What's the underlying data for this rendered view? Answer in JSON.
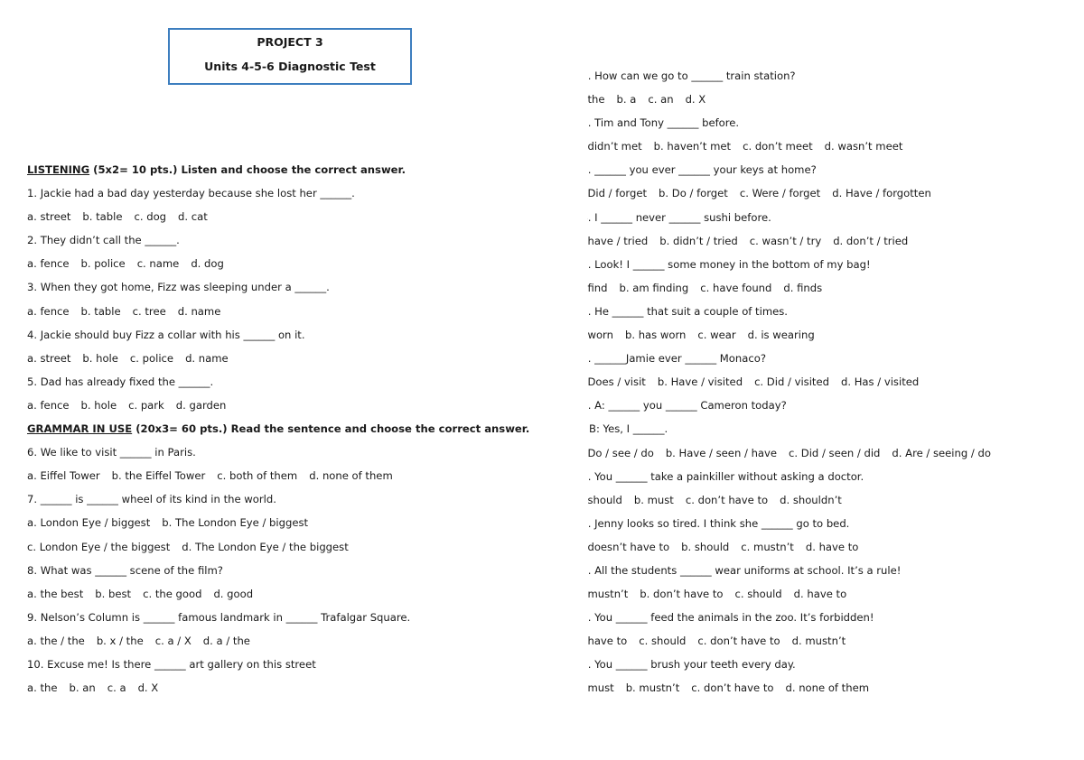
{
  "header": {
    "project": "PROJECT 3",
    "subtitle": "Units 4-5-6 Diagnostic Test"
  },
  "listening": {
    "label": "LISTENING",
    "instructions": " (5x2= 10 pts.) Listen and choose the correct answer.",
    "questions": [
      {
        "text": "1. Jackie had a bad day yesterday because she lost her ______.",
        "options": [
          "a. street",
          "b. table",
          "c. dog",
          "d. cat"
        ]
      },
      {
        "text": "2. They didn’t call the ______.",
        "options": [
          "a. fence",
          "b. police",
          "c. name",
          "d. dog"
        ]
      },
      {
        "text": "3. When they got home, Fizz was sleeping under a ______.",
        "options": [
          "a. fence",
          "b. table",
          "c. tree",
          "d. name"
        ]
      },
      {
        "text": "4. Jackie should buy Fizz a collar with his ______ on it.",
        "options": [
          "a. street",
          "b. hole",
          "c. police",
          "d. name"
        ]
      },
      {
        "text": "5. Dad has already fixed the ______.",
        "options": [
          "a. fence",
          "b. hole",
          "c. park",
          "d. garden"
        ]
      }
    ]
  },
  "grammar": {
    "label": "GRAMMAR IN USE",
    "instructions": " (20x3= 60 pts.) Read the sentence and choose the correct answer.",
    "questions": [
      {
        "text": "6. We like to visit ______ in Paris.",
        "options": [
          "a. Eiffel Tower",
          "b. the Eiffel Tower",
          "c. both of them",
          "d. none of them"
        ]
      },
      {
        "text": "7. ______ is ______ wheel of its kind in the world.",
        "options": [
          "a. London Eye / biggest",
          "b. The London Eye / biggest"
        ],
        "options2": [
          "c. London Eye / the biggest",
          "d. The London Eye / the biggest"
        ]
      },
      {
        "text": "8. What was ______ scene of the film?",
        "options": [
          "a. the best",
          "b. best",
          "c. the good",
          "d. good"
        ]
      },
      {
        "text": "9. Nelson’s Column is ______ famous landmark in ______ Trafalgar Square.",
        "options": [
          "a. the / the",
          "b. x / the",
          "c. a / X",
          "d. a / the"
        ]
      },
      {
        "text": "10. Excuse me! Is there ______ art gallery on this street",
        "options": [
          "a. the",
          "b. an",
          "c. a",
          "d. X"
        ]
      },
      {
        "text": "11. How can we go to ______ train station?",
        "options": [
          "a. the",
          "b. a",
          "c. an",
          "d. X"
        ]
      },
      {
        "text": "12. Tim and Tony ______ before.",
        "options": [
          "a. didn’t met",
          "b. haven’t met",
          "c. don’t meet",
          "d. wasn’t meet"
        ]
      },
      {
        "text": "13. ______ you ever ______ your keys at home?",
        "options": [
          "a. Did / forget",
          "b. Do / forget",
          "c. Were / forget",
          "d. Have / forgotten"
        ]
      },
      {
        "text": "14. I ______ never ______ sushi before.",
        "options": [
          "a. have / tried",
          "b. didn’t / tried",
          "c. wasn’t / try",
          "d. don’t / tried"
        ]
      },
      {
        "text": "15. Look! I ______ some money in the bottom of my bag!",
        "options": [
          "a. find",
          "b. am finding",
          "c. have found",
          "d. finds"
        ]
      },
      {
        "text": "16. He ______ that suit a couple of times.",
        "options": [
          "a. worn",
          "b. has worn",
          "c. wear",
          "d. is wearing"
        ]
      },
      {
        "text": "17. ______Jamie ever ______ Monaco?",
        "options": [
          "a. Does / visit",
          "b. Have / visited",
          "c. Did / visited",
          "d. Has / visited"
        ]
      },
      {
        "text": "18. A: ______ you ______ Cameron today?",
        "reply": "B: Yes, I ______.",
        "options": [
          "a. Do / see / do",
          "b. Have / seen / have",
          "c. Did / seen / did",
          "d. Are / seeing / do"
        ]
      },
      {
        "text": "19. You ______ take a painkiller without asking a doctor.",
        "options": [
          "a. should",
          "b. must",
          "c. don’t have to",
          "d. shouldn’t"
        ]
      },
      {
        "text": "20. Jenny looks so tired. I think she ______ go to bed.",
        "options": [
          "a. doesn’t have to",
          "b. should",
          "c. mustn’t",
          "d. have to"
        ]
      },
      {
        "text": "21. All the students ______ wear uniforms at school. It’s a rule!",
        "options": [
          "a. mustn’t",
          "b. don’t have to",
          "c. should",
          "d. have to"
        ]
      },
      {
        "text": "22. You ______ feed the animals in the zoo. It’s forbidden!",
        "options": [
          "a. have to",
          "c. should",
          "c. don’t have to",
          "d. mustn’t"
        ]
      },
      {
        "text": "23. You ______ brush your teeth every day.",
        "options": [
          "a. must",
          "b. mustn’t",
          "c. don’t have to",
          "d. none of them"
        ]
      }
    ]
  }
}
